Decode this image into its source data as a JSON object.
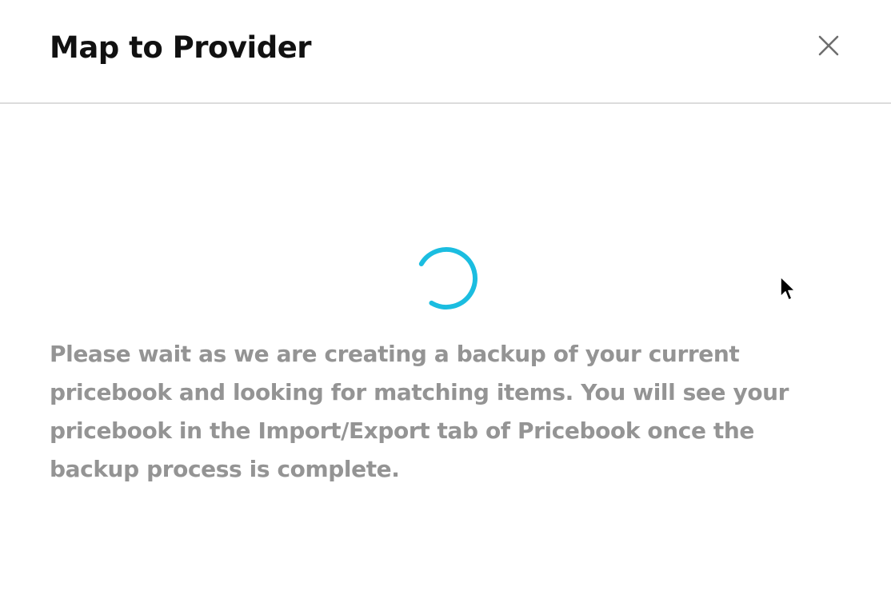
{
  "dialog": {
    "title": "Map to Provider",
    "close_icon": "close-icon",
    "spinner_icon": "loading-spinner-icon",
    "message": "Please wait as we are creating a backup of your current pricebook and looking for matching items. You will see your pricebook in the Import/Export tab of Pricebook once the backup process is complete."
  },
  "colors": {
    "title": "#111111",
    "message": "#949494",
    "spinner": "#1bbde0",
    "divider": "#dcdcdc",
    "close_icon": "#6e6e6e"
  }
}
